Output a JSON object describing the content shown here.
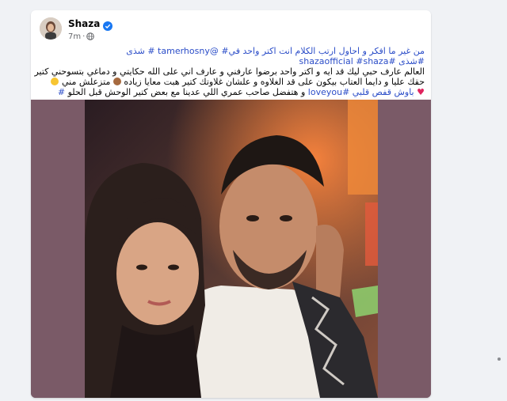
{
  "post": {
    "author": "Shaza",
    "time": "7m",
    "meta_separator": "·",
    "lines": {
      "line1": {
        "text_before_mention": "من غير ما افكر و احاول ارتب الكلام انت اكتر واحد في",
        "tag_num": "#",
        "mention": "@tamerhosny",
        "space": " ",
        "tag_shaza_ar": "# شذى"
      },
      "line2": {
        "tag1": "#shaza",
        "tag2": "#shazaofficial",
        "tag3": "#شذى"
      },
      "line3": "العالم عارف حبي ليك قد ايه و اكتر واحد برضوا عارفني و عارف اني على الله حكايتي و دماغي بتسوحني كتير",
      "line4": "حقك عليا و دايما العتاب بيكون على قد الغلاوه و علشان غلاوتك كتير هبت معايا زياده",
      "line4_end": "متزعلش مني",
      "line5": {
        "part1": "باوش قفص قلبي",
        "tag": "#loveyou",
        "part2": "و هتفضل صاحب عمري اللي عدينا مع بعض كتير الوحش قبل الحلو",
        "tag_num": "#"
      }
    },
    "photo_alt": "Selfie of two people at a party"
  },
  "icons": {
    "verified": "verified-badge-icon",
    "audience": "globe-icon",
    "heart": "red-heart-emoji",
    "laugh": "laughing-emoji",
    "monkey": "see-no-evil-monkey-emoji"
  },
  "colors": {
    "link": "#2b4dc8",
    "verified": "#1877f2",
    "page_bg": "#f0f2f5"
  }
}
